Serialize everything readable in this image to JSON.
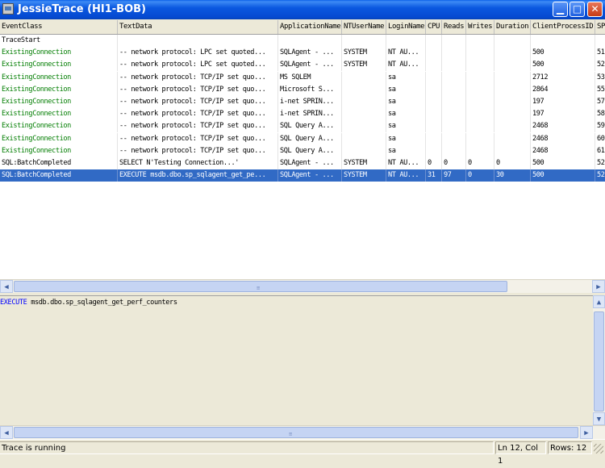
{
  "window": {
    "title": "JessieTrace (HI1-BOB)"
  },
  "columns": [
    "EventClass",
    "TextData",
    "ApplicationName",
    "NTUserName",
    "LoginName",
    "CPU",
    "Reads",
    "Writes",
    "Duration",
    "ClientProcessID",
    "SP"
  ],
  "rows": [
    {
      "EventClass": "TraceStart",
      "TextData": "",
      "ApplicationName": "",
      "NTUserName": "",
      "LoginName": "",
      "CPU": "",
      "Reads": "",
      "Writes": "",
      "Duration": "",
      "ClientProcessID": "",
      "SP": ""
    },
    {
      "EventClass": "ExistingConnection",
      "TextData": "-- network protocol: LPC set quoted...",
      "ApplicationName": "SQLAgent - ...",
      "NTUserName": "SYSTEM",
      "LoginName": "NT AU...",
      "CPU": "",
      "Reads": "",
      "Writes": "",
      "Duration": "",
      "ClientProcessID": "500",
      "SP": "51"
    },
    {
      "EventClass": "ExistingConnection",
      "TextData": "-- network protocol: LPC set quoted...",
      "ApplicationName": "SQLAgent - ...",
      "NTUserName": "SYSTEM",
      "LoginName": "NT AU...",
      "CPU": "",
      "Reads": "",
      "Writes": "",
      "Duration": "",
      "ClientProcessID": "500",
      "SP": "52"
    },
    {
      "EventClass": "ExistingConnection",
      "TextData": "-- network protocol: TCP/IP set quo...",
      "ApplicationName": "MS SQLEM",
      "NTUserName": "",
      "LoginName": "sa",
      "CPU": "",
      "Reads": "",
      "Writes": "",
      "Duration": "",
      "ClientProcessID": "2712",
      "SP": "53"
    },
    {
      "EventClass": "ExistingConnection",
      "TextData": "-- network protocol: TCP/IP set quo...",
      "ApplicationName": "Microsoft S...",
      "NTUserName": "",
      "LoginName": "sa",
      "CPU": "",
      "Reads": "",
      "Writes": "",
      "Duration": "",
      "ClientProcessID": "2864",
      "SP": "55"
    },
    {
      "EventClass": "ExistingConnection",
      "TextData": "-- network protocol: TCP/IP set quo...",
      "ApplicationName": "i-net SPRIN...",
      "NTUserName": "",
      "LoginName": "sa",
      "CPU": "",
      "Reads": "",
      "Writes": "",
      "Duration": "",
      "ClientProcessID": "197",
      "SP": "57"
    },
    {
      "EventClass": "ExistingConnection",
      "TextData": "-- network protocol: TCP/IP set quo...",
      "ApplicationName": "i-net SPRIN...",
      "NTUserName": "",
      "LoginName": "sa",
      "CPU": "",
      "Reads": "",
      "Writes": "",
      "Duration": "",
      "ClientProcessID": "197",
      "SP": "58"
    },
    {
      "EventClass": "ExistingConnection",
      "TextData": "-- network protocol: TCP/IP set quo...",
      "ApplicationName": "SQL Query A...",
      "NTUserName": "",
      "LoginName": "sa",
      "CPU": "",
      "Reads": "",
      "Writes": "",
      "Duration": "",
      "ClientProcessID": "2468",
      "SP": "59"
    },
    {
      "EventClass": "ExistingConnection",
      "TextData": "-- network protocol: TCP/IP set quo...",
      "ApplicationName": "SQL Query A...",
      "NTUserName": "",
      "LoginName": "sa",
      "CPU": "",
      "Reads": "",
      "Writes": "",
      "Duration": "",
      "ClientProcessID": "2468",
      "SP": "60"
    },
    {
      "EventClass": "ExistingConnection",
      "TextData": "-- network protocol: TCP/IP set quo...",
      "ApplicationName": "SQL Query A...",
      "NTUserName": "",
      "LoginName": "sa",
      "CPU": "",
      "Reads": "",
      "Writes": "",
      "Duration": "",
      "ClientProcessID": "2468",
      "SP": "61"
    },
    {
      "EventClass": "SQL:BatchCompleted",
      "TextData": "SELECT N'Testing Connection...'",
      "ApplicationName": "SQLAgent - ...",
      "NTUserName": "SYSTEM",
      "LoginName": "NT AU...",
      "CPU": "0",
      "Reads": "0",
      "Writes": "0",
      "Duration": "0",
      "ClientProcessID": "500",
      "SP": "52"
    },
    {
      "EventClass": "SQL:BatchCompleted",
      "TextData": "EXECUTE msdb.dbo.sp_sqlagent_get_pe...",
      "ApplicationName": "SQLAgent - ...",
      "NTUserName": "SYSTEM",
      "LoginName": "NT AU...",
      "CPU": "31",
      "Reads": "97",
      "Writes": "0",
      "Duration": "30",
      "ClientProcessID": "500",
      "SP": "52"
    }
  ],
  "selected_row": 11,
  "detail": {
    "keyword": "EXECUTE",
    "rest": " msdb.dbo.sp_sqlagent_get_perf_counters"
  },
  "status": {
    "message": "Trace is running",
    "position": "Ln 12, Col 1",
    "rows": "Rows: 12"
  },
  "colors": {
    "titlebar": "#0549d1",
    "selection": "#316ac5",
    "existing_connection": "#007d00",
    "keyword": "#0000ff"
  }
}
